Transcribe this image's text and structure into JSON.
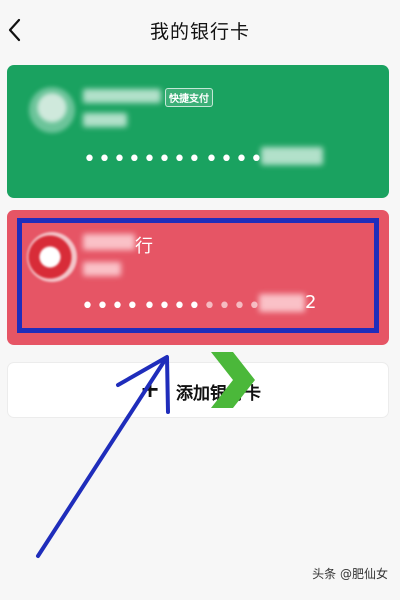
{
  "header": {
    "title": "我的银行卡",
    "back_icon": "chevron-left-icon"
  },
  "cards": [
    {
      "bank_label": "",
      "badge": "快捷支付",
      "number_mask": [
        "••••",
        "••••",
        "••••"
      ],
      "color": "#1aa260"
    },
    {
      "bank_label": "行",
      "number_mask": [
        "••••",
        "••••",
        "••••"
      ],
      "last_digit": "2",
      "color": "#e65565"
    }
  ],
  "add_card": {
    "plus": "+",
    "label": "添加银行卡"
  },
  "annotation": {
    "highlight_color": "#1f2dbb",
    "arrow_color": "#1f2dbb",
    "chevron_color": "#4bb83a"
  },
  "watermark": "头条 @肥仙女"
}
